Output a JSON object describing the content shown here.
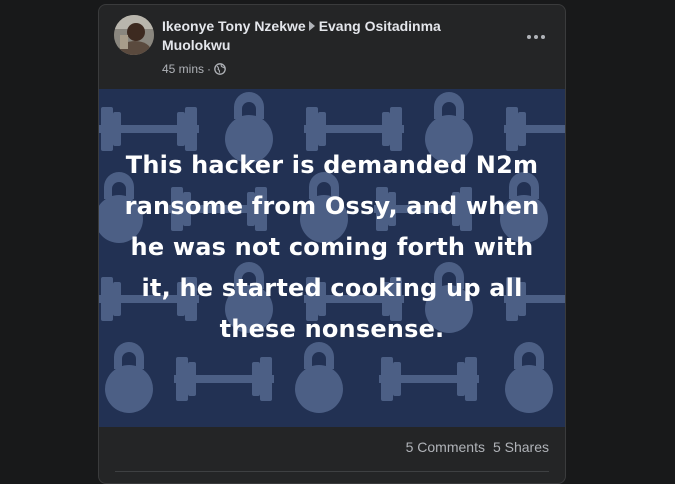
{
  "post": {
    "author": "Ikeonye Tony Nzekwe",
    "target": "Evang Ositadinma Muolokwu",
    "time": "45 mins",
    "dot": "·",
    "privacy_icon": "globe-icon",
    "more_icon": "more-horizontal-icon",
    "image_text": "This hacker is demanded N2m ransome from Ossy, and when he was not coming forth with it, he started cooking up all these nonsense.",
    "comments": "5 Comments",
    "shares": "5 Shares"
  },
  "colors": {
    "background": "#18191a",
    "card": "#242526",
    "image_bg": "#223153",
    "image_pattern": "#4c5f85",
    "text_primary": "#e4e6eb",
    "text_secondary": "#b0b3b8"
  }
}
